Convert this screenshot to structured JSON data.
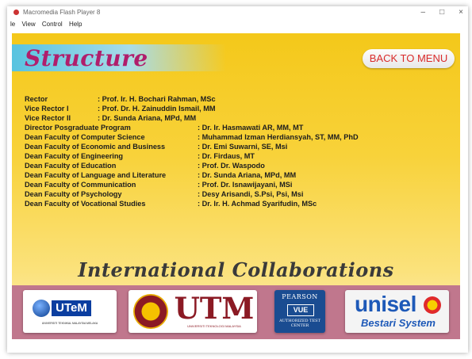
{
  "window": {
    "title": "Macromedia Flash Player 8",
    "controls": {
      "minimize": "–",
      "maximize": "□",
      "close": "×"
    }
  },
  "menu": [
    "le",
    "View",
    "Control",
    "Help"
  ],
  "heading": "Structure",
  "back_button": "BACK TO MENU",
  "people_short": [
    {
      "role": "Rector",
      "name": ": Prof. Ir. H. Bochari Rahman, MSc"
    },
    {
      "role": "Vice Rector I",
      "name": ": Prof. Dr. H. Zainuddin Ismail, MM"
    },
    {
      "role": "Vice Rector II",
      "name": ": Dr. Sunda Ariana, MPd, MM"
    }
  ],
  "people_long": [
    {
      "role": "Director Posgraduate Program",
      "name": ": Dr. Ir. Hasmawati AR, MM, MT"
    },
    {
      "role": "Dean Faculty of Computer Science",
      "name": ": Muhammad Izman Herdiansyah, ST, MM, PhD"
    },
    {
      "role": "Dean Faculty of Economic and Business",
      "name": ": Dr. Emi Suwarni, SE, Msi"
    },
    {
      "role": "Dean Faculty of Engineering",
      "name": ": Dr. Firdaus, MT"
    },
    {
      "role": "Dean Faculty of Education",
      "name": ": Prof. Dr. Waspodo"
    },
    {
      "role": "Dean Faculty of Language and Literature",
      "name": ": Dr. Sunda Ariana, MPd, MM"
    },
    {
      "role": "Dean Faculty of Communication",
      "name": ": Prof. Dr. Isnawijayani, MSi"
    },
    {
      "role": "Dean Faculty of Psychology",
      "name": ": Desy Arisandi, S.Psi, Psi, Msi"
    },
    {
      "role": "Dean Faculty of Vocational Studies",
      "name": ": Dr. Ir. H. Achmad Syarifudin, MSc"
    }
  ],
  "collab_title": "International Collaborations",
  "logos": {
    "utem": {
      "name": "UTeM",
      "sub": "UNIVERSITI TEKNIKAL MALAYSIA MELAKA"
    },
    "utm": {
      "name": "UTM",
      "sub": "UNIVERSITI TEKNOLOGI MALAYSIA"
    },
    "pearson": {
      "name": "PEARSON",
      "vue": "VUE",
      "sub": "AUTHORIZED TEST CENTER"
    },
    "unisel": {
      "name": "unisel",
      "sub": "Bestari System"
    }
  },
  "colors": {
    "background_top": "#f4c81a",
    "heading": "#b01e6c",
    "back_button_text": "#d92b2b",
    "logo_strip": "#c0778d"
  }
}
